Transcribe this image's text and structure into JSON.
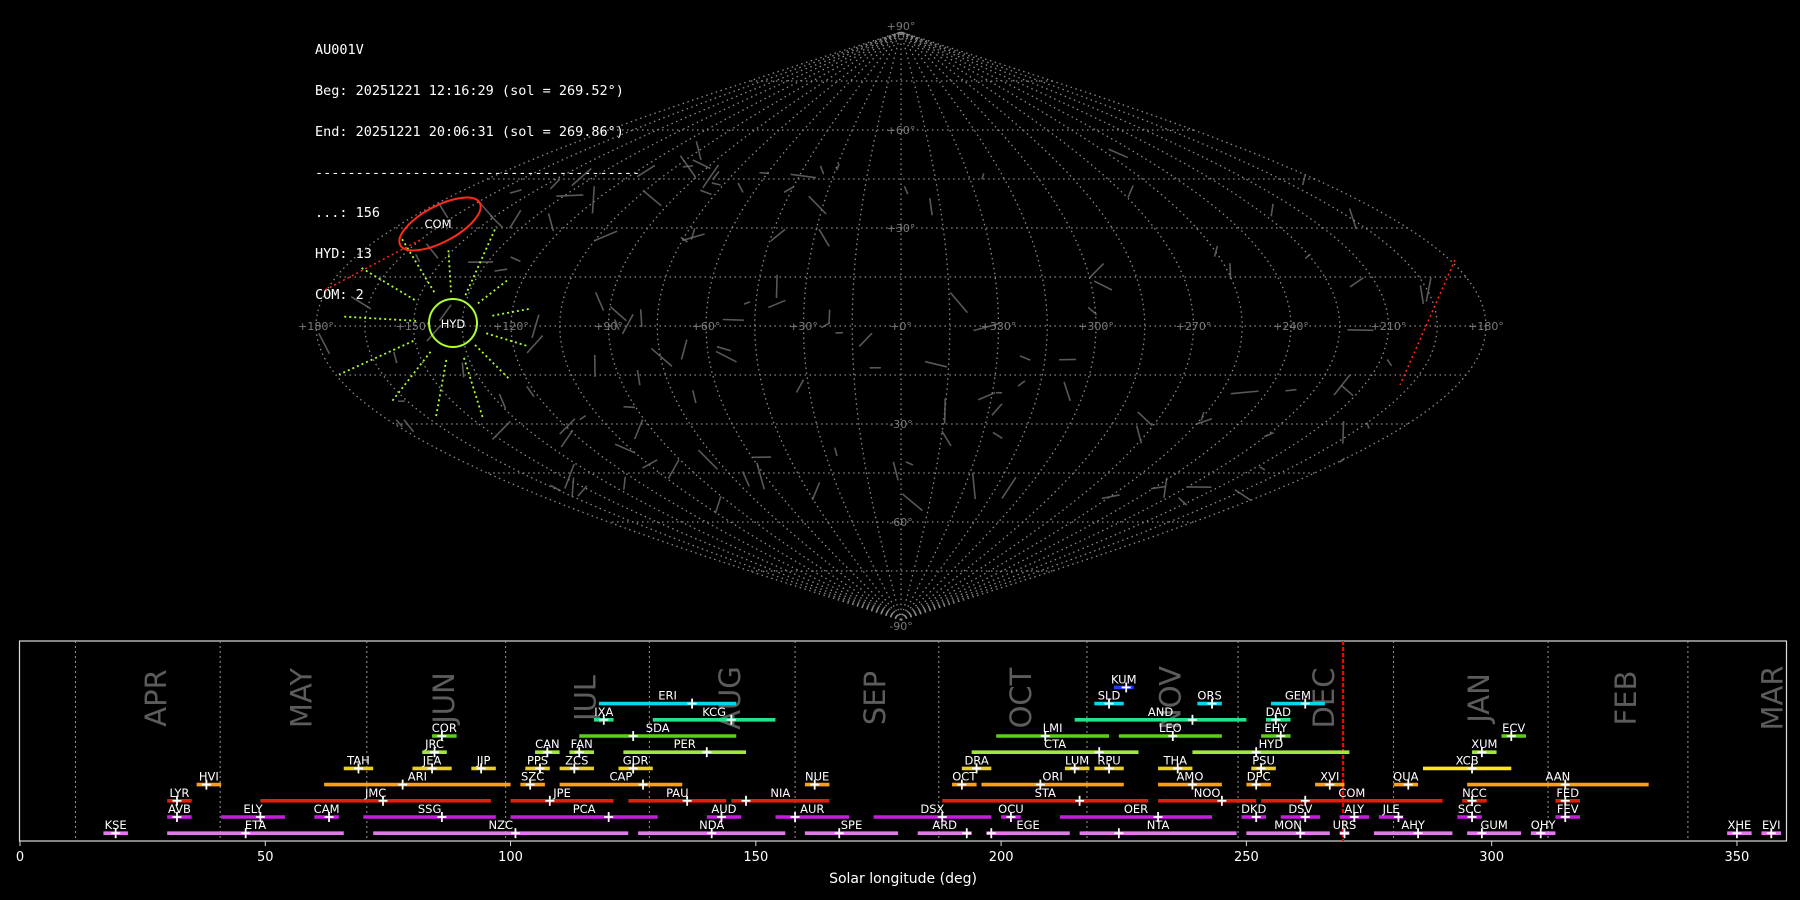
{
  "info": {
    "station": "AU001V",
    "begin": "Beg: 20251221 12:16:29 (sol = 269.52°)",
    "end": "End: 20251221 20:06:31 (sol = 269.86°)",
    "separator": "----------------------------------------",
    "counts": [
      "...: 156",
      "HYD: 13",
      "COM: 2"
    ]
  },
  "colors": {
    "background": "#000000",
    "grid": "#8a8a8a",
    "hyd": "#adff2f",
    "com": "#ff2a1a",
    "current_sol": "#ff0000"
  },
  "chart_data": [
    {
      "type": "scatter",
      "projection": "sinusoidal sky map",
      "lat_labels": [
        "+90°",
        "+60°",
        "+30°",
        "-30°",
        "-60°",
        "-90°"
      ],
      "lon_labels": [
        "+180°",
        "+150°",
        "+120°",
        "+90°",
        "+60°",
        "+30°",
        "+0°",
        "+330°",
        "+300°",
        "+270°",
        "+240°",
        "+210°",
        "+180°"
      ],
      "radiants": [
        {
          "name": "HYD",
          "lon": 152,
          "lat": 0,
          "radius_deg": 11,
          "color": "#adff2f"
        },
        {
          "name": "COM",
          "lon": 148,
          "lat": 22,
          "radius_deg": 8,
          "color": "#ff2a1a"
        }
      ]
    },
    {
      "type": "timeline",
      "xlabel": "Solar longitude (deg)",
      "xlim": [
        0,
        360
      ],
      "xticks": [
        0,
        50,
        100,
        150,
        200,
        250,
        300,
        350
      ],
      "current_sol": 269.7,
      "months": [
        {
          "label": "APR",
          "start": 11.3
        },
        {
          "label": "MAY",
          "start": 40.8
        },
        {
          "label": "JUN",
          "start": 70.7
        },
        {
          "label": "JUL",
          "start": 99.0
        },
        {
          "label": "AUG",
          "start": 128.3
        },
        {
          "label": "SEP",
          "start": 158.0
        },
        {
          "label": "OCT",
          "start": 187.3
        },
        {
          "label": "NOV",
          "start": 217.5
        },
        {
          "label": "DEC",
          "start": 248.3
        },
        {
          "label": "JAN",
          "start": 280.0
        },
        {
          "label": "FEB",
          "start": 311.5
        },
        {
          "label": "MAR",
          "start": 340.0
        }
      ],
      "showers": [
        {
          "code": "KUM",
          "row": 8,
          "start": 223,
          "end": 227,
          "peak": 225.5,
          "color": "#1e3cff"
        },
        {
          "code": "ERI",
          "row": 7,
          "start": 118,
          "end": 146,
          "peak": 137,
          "color": "#00d7f0"
        },
        {
          "code": "SLD",
          "row": 7,
          "start": 219,
          "end": 225,
          "peak": 222,
          "color": "#00d7f0"
        },
        {
          "code": "ORS",
          "row": 7,
          "start": 240,
          "end": 245,
          "peak": 243,
          "color": "#00d7f0"
        },
        {
          "code": "GEM",
          "row": 7,
          "start": 255,
          "end": 266,
          "peak": 262,
          "color": "#00d7f0"
        },
        {
          "code": "IXA",
          "row": 6,
          "start": 117,
          "end": 121,
          "peak": 119,
          "color": "#28e08a"
        },
        {
          "code": "KCG",
          "row": 6,
          "start": 129,
          "end": 154,
          "peak": 145,
          "color": "#28e08a"
        },
        {
          "code": "AND",
          "row": 6,
          "start": 215,
          "end": 250,
          "peak": 239,
          "color": "#28e08a"
        },
        {
          "code": "DAD",
          "row": 6,
          "start": 254,
          "end": 259,
          "peak": 256,
          "color": "#28e08a"
        },
        {
          "code": "COR",
          "row": 5,
          "start": 84,
          "end": 89,
          "peak": 86,
          "color": "#5bd01a"
        },
        {
          "code": "SDA",
          "row": 5,
          "start": 114,
          "end": 146,
          "peak": 125,
          "color": "#5bd01a"
        },
        {
          "code": "LMI",
          "row": 5,
          "start": 199,
          "end": 222,
          "peak": 209,
          "color": "#5bd01a"
        },
        {
          "code": "LEO",
          "row": 5,
          "start": 224,
          "end": 245,
          "peak": 235,
          "color": "#5bd01a"
        },
        {
          "code": "EHY",
          "row": 5,
          "start": 253,
          "end": 259,
          "peak": 257,
          "color": "#5bd01a"
        },
        {
          "code": "ECV",
          "row": 5,
          "start": 302,
          "end": 307,
          "peak": 304,
          "color": "#5bd01a"
        },
        {
          "code": "JRC",
          "row": 4,
          "start": 82,
          "end": 87,
          "peak": 84.5,
          "color": "#a2e83c"
        },
        {
          "code": "CAN",
          "row": 4,
          "start": 105,
          "end": 110,
          "peak": 107.5,
          "color": "#a2e83c"
        },
        {
          "code": "FAN",
          "row": 4,
          "start": 112,
          "end": 117,
          "peak": 114,
          "color": "#a2e83c"
        },
        {
          "code": "PER",
          "row": 4,
          "start": 123,
          "end": 148,
          "peak": 140,
          "color": "#a2e83c"
        },
        {
          "code": "CTA",
          "row": 4,
          "start": 194,
          "end": 228,
          "peak": 220,
          "color": "#a2e83c"
        },
        {
          "code": "HYD",
          "row": 4,
          "start": 239,
          "end": 271,
          "peak": 252,
          "color": "#a2e83c"
        },
        {
          "code": "XUM",
          "row": 4,
          "start": 296,
          "end": 301,
          "peak": 298,
          "color": "#a2e83c"
        },
        {
          "code": "TAH",
          "row": 3,
          "start": 66,
          "end": 72,
          "peak": 69,
          "color": "#e8d020"
        },
        {
          "code": "JEA",
          "row": 3,
          "start": 80,
          "end": 88,
          "peak": 84,
          "color": "#e8d020"
        },
        {
          "code": "JIP",
          "row": 3,
          "start": 92,
          "end": 97,
          "peak": 94,
          "color": "#e8d020"
        },
        {
          "code": "PPS",
          "row": 3,
          "start": 103,
          "end": 108,
          "peak": 106,
          "color": "#e8d020"
        },
        {
          "code": "ZCS",
          "row": 3,
          "start": 110,
          "end": 117,
          "peak": 113,
          "color": "#e8d020"
        },
        {
          "code": "GDR",
          "row": 3,
          "start": 122,
          "end": 129,
          "peak": 125,
          "color": "#e8d020"
        },
        {
          "code": "DRA",
          "row": 3,
          "start": 192,
          "end": 198,
          "peak": 195,
          "color": "#e8d020"
        },
        {
          "code": "LUM",
          "row": 3,
          "start": 213,
          "end": 218,
          "peak": 215,
          "color": "#e8d020"
        },
        {
          "code": "RPU",
          "row": 3,
          "start": 219,
          "end": 225,
          "peak": 222,
          "color": "#e8d020"
        },
        {
          "code": "THA",
          "row": 3,
          "start": 232,
          "end": 239,
          "peak": 236,
          "color": "#e8d020"
        },
        {
          "code": "PSU",
          "row": 3,
          "start": 251,
          "end": 256,
          "peak": 253,
          "color": "#e8d020"
        },
        {
          "code": "XCB",
          "row": 3,
          "start": 286,
          "end": 304,
          "peak": 296,
          "color": "#ffe81a"
        },
        {
          "code": "HVI",
          "row": 2,
          "start": 36,
          "end": 41,
          "peak": 38,
          "color": "#ffa012"
        },
        {
          "code": "ARI",
          "row": 2,
          "start": 62,
          "end": 100,
          "peak": 78,
          "color": "#ffa012"
        },
        {
          "code": "SZC",
          "row": 2,
          "start": 102,
          "end": 107,
          "peak": 104,
          "color": "#ffa012"
        },
        {
          "code": "CAP",
          "row": 2,
          "start": 110,
          "end": 135,
          "peak": 127,
          "color": "#ffa012"
        },
        {
          "code": "NUE",
          "row": 2,
          "start": 160,
          "end": 165,
          "peak": 162,
          "color": "#ffa012"
        },
        {
          "code": "OCT",
          "row": 2,
          "start": 190,
          "end": 195,
          "peak": 192,
          "color": "#ffa012"
        },
        {
          "code": "ORI",
          "row": 2,
          "start": 196,
          "end": 225,
          "peak": 208,
          "color": "#ffa012"
        },
        {
          "code": "AMO",
          "row": 2,
          "start": 232,
          "end": 245,
          "peak": 239,
          "color": "#ffa012"
        },
        {
          "code": "DPC",
          "row": 2,
          "start": 250,
          "end": 255,
          "peak": 252,
          "color": "#ffa012"
        },
        {
          "code": "XVI",
          "row": 2,
          "start": 264,
          "end": 270,
          "peak": 267,
          "color": "#ffa012"
        },
        {
          "code": "QUA",
          "row": 2,
          "start": 280,
          "end": 285,
          "peak": 283,
          "color": "#ffa012"
        },
        {
          "code": "AAN",
          "row": 2,
          "start": 295,
          "end": 332,
          "peak": 315,
          "color": "#ffa012"
        },
        {
          "code": "LYR",
          "row": 1,
          "start": 30,
          "end": 35,
          "peak": 32,
          "color": "#e01e10"
        },
        {
          "code": "JMC",
          "row": 1,
          "start": 49,
          "end": 96,
          "peak": 74,
          "color": "#e01e10"
        },
        {
          "code": "JPE",
          "row": 1,
          "start": 100,
          "end": 121,
          "peak": 108,
          "color": "#e01e10"
        },
        {
          "code": "PAU",
          "row": 1,
          "start": 124,
          "end": 144,
          "peak": 136,
          "color": "#e01e10"
        },
        {
          "code": "NIA",
          "row": 1,
          "start": 145,
          "end": 165,
          "peak": 148,
          "color": "#e01e10"
        },
        {
          "code": "STA",
          "row": 1,
          "start": 188,
          "end": 230,
          "peak": 216,
          "color": "#e01e10"
        },
        {
          "code": "NOO",
          "row": 1,
          "start": 232,
          "end": 252,
          "peak": 245,
          "color": "#e01e10"
        },
        {
          "code": "COM",
          "row": 1,
          "start": 253,
          "end": 290,
          "peak": 262,
          "color": "#e01e10"
        },
        {
          "code": "NCC",
          "row": 1,
          "start": 294,
          "end": 299,
          "peak": 296,
          "color": "#e01e10"
        },
        {
          "code": "FED",
          "row": 1,
          "start": 313,
          "end": 318,
          "peak": 315,
          "color": "#e01e10"
        },
        {
          "code": "AVB",
          "row": 0,
          "start": 30,
          "end": 35,
          "peak": 32,
          "color": "#c51edc"
        },
        {
          "code": "ELY",
          "row": 0,
          "start": 41,
          "end": 54,
          "peak": 49,
          "color": "#c51edc"
        },
        {
          "code": "CAM",
          "row": 0,
          "start": 60,
          "end": 65,
          "peak": 63,
          "color": "#c51edc"
        },
        {
          "code": "SSG",
          "row": 0,
          "start": 70,
          "end": 97,
          "peak": 86,
          "color": "#c51edc"
        },
        {
          "code": "PCA",
          "row": 0,
          "start": 100,
          "end": 130,
          "peak": 120,
          "color": "#c51edc"
        },
        {
          "code": "AUD",
          "row": 0,
          "start": 140,
          "end": 147,
          "peak": 143,
          "color": "#c51edc"
        },
        {
          "code": "AUR",
          "row": 0,
          "start": 154,
          "end": 169,
          "peak": 158,
          "color": "#c51edc"
        },
        {
          "code": "DSX",
          "row": 0,
          "start": 174,
          "end": 198,
          "peak": 188,
          "color": "#c51edc"
        },
        {
          "code": "OCU",
          "row": 0,
          "start": 200,
          "end": 204,
          "peak": 202,
          "color": "#c51edc"
        },
        {
          "code": "OER",
          "row": 0,
          "start": 212,
          "end": 243,
          "peak": 232,
          "color": "#c51edc"
        },
        {
          "code": "DKD",
          "row": 0,
          "start": 249,
          "end": 254,
          "peak": 252,
          "color": "#c51edc"
        },
        {
          "code": "DSV",
          "row": 0,
          "start": 257,
          "end": 265,
          "peak": 262,
          "color": "#c51edc"
        },
        {
          "code": "ALY",
          "row": 0,
          "start": 269,
          "end": 275,
          "peak": 272,
          "color": "#c51edc"
        },
        {
          "code": "JLE",
          "row": 0,
          "start": 277,
          "end": 282,
          "peak": 281,
          "color": "#c51edc"
        },
        {
          "code": "SCC",
          "row": 0,
          "start": 293,
          "end": 298,
          "peak": 296,
          "color": "#c51edc"
        },
        {
          "code": "FEV",
          "row": 0,
          "start": 313,
          "end": 318,
          "peak": 315,
          "color": "#c51edc"
        },
        {
          "code": "KSE",
          "row": -1,
          "start": 17,
          "end": 22,
          "peak": 19.5,
          "color": "#e07ae8"
        },
        {
          "code": "ETA",
          "row": -1,
          "start": 30,
          "end": 66,
          "peak": 46,
          "color": "#e07ae8"
        },
        {
          "code": "NZC",
          "row": -1,
          "start": 72,
          "end": 124,
          "peak": 101,
          "color": "#e07ae8"
        },
        {
          "code": "NDA",
          "row": -1,
          "start": 126,
          "end": 156,
          "peak": 141,
          "color": "#e07ae8"
        },
        {
          "code": "SPE",
          "row": -1,
          "start": 160,
          "end": 179,
          "peak": 167,
          "color": "#e07ae8"
        },
        {
          "code": "ARD",
          "row": -1,
          "start": 183,
          "end": 194,
          "peak": 193,
          "color": "#e07ae8"
        },
        {
          "code": "EGE",
          "row": -1,
          "start": 197,
          "end": 214,
          "peak": 198,
          "color": "#e07ae8"
        },
        {
          "code": "NTA",
          "row": -1,
          "start": 216,
          "end": 248,
          "peak": 224,
          "color": "#e07ae8"
        },
        {
          "code": "MON",
          "row": -1,
          "start": 250,
          "end": 267,
          "peak": 261,
          "color": "#e07ae8"
        },
        {
          "code": "URS",
          "row": -1,
          "start": 269,
          "end": 271,
          "peak": 270,
          "color": "#e07ae8"
        },
        {
          "code": "AHY",
          "row": -1,
          "start": 276,
          "end": 292,
          "peak": 285,
          "color": "#e07ae8"
        },
        {
          "code": "GUM",
          "row": -1,
          "start": 295,
          "end": 306,
          "peak": 298,
          "color": "#e07ae8"
        },
        {
          "code": "OHY",
          "row": -1,
          "start": 308,
          "end": 313,
          "peak": 310,
          "color": "#e07ae8"
        },
        {
          "code": "XHE",
          "row": -1,
          "start": 348,
          "end": 353,
          "peak": 350,
          "color": "#e07ae8"
        },
        {
          "code": "EVI",
          "row": -1,
          "start": 355,
          "end": 359,
          "peak": 357,
          "color": "#e07ae8"
        }
      ]
    }
  ]
}
